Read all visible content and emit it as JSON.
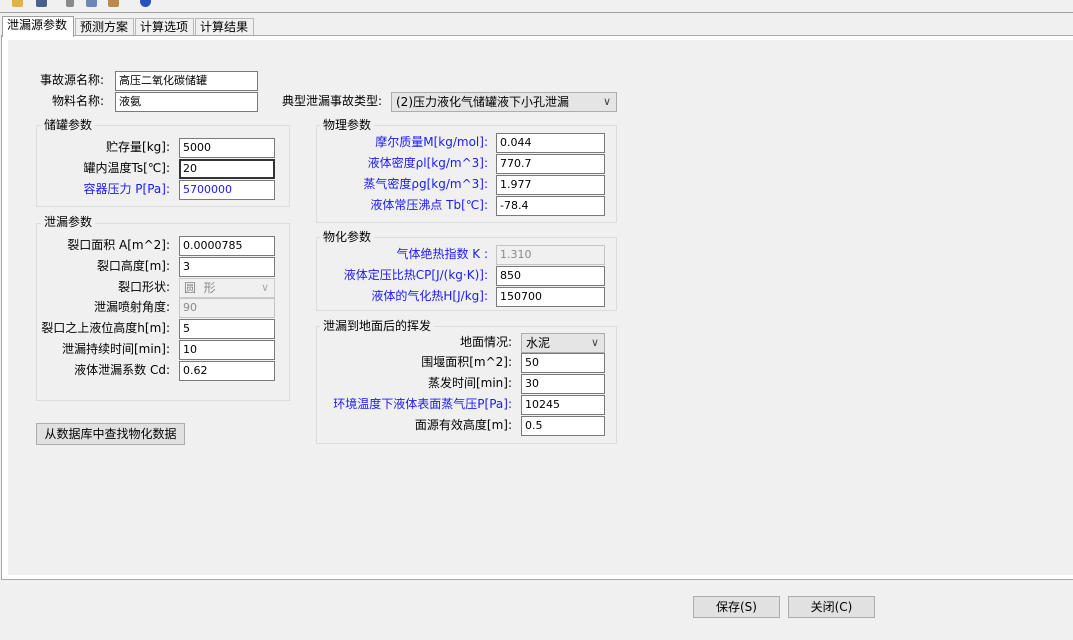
{
  "tabs": [
    "泄漏源参数",
    "预测方案",
    "计算选项",
    "计算结果"
  ],
  "header": {
    "source_name_label": "事故源名称:",
    "source_name_value": "高压二氧化碳储罐",
    "material_label": "物料名称:",
    "material_value": "液氨",
    "accident_type_label": "典型泄漏事故类型:",
    "accident_type_value": "(2)压力液化气储罐液下小孔泄漏"
  },
  "tank": {
    "title": "储罐参数",
    "fields": [
      {
        "label": "贮存量[kg]:",
        "value": "5000"
      },
      {
        "label": "罐内温度Ts[℃]:",
        "value": "20"
      },
      {
        "label": "容器压力 P[Pa]:",
        "value": "5700000"
      }
    ]
  },
  "leak": {
    "title": "泄漏参数",
    "area_label": "裂口面积 A[m^2]:",
    "area_value": "0.0000785",
    "height_label": "裂口高度[m]:",
    "height_value": "3",
    "shape_label": "裂口形状:",
    "shape_value": "圆  形",
    "angle_label": "泄漏喷射角度:",
    "angle_value": "90",
    "liquid_height_label": "裂口之上液位高度h[m]:",
    "liquid_height_value": "5",
    "duration_label": "泄漏持续时间[min]:",
    "duration_value": "10",
    "coef_label": "液体泄漏系数  Cd:",
    "coef_value": "0.62"
  },
  "phys": {
    "title": "物理参数",
    "fields": [
      {
        "label": "摩尔质量M[kg/mol]:",
        "value": "0.044"
      },
      {
        "label": "液体密度ρl[kg/m^3]:",
        "value": "770.7"
      },
      {
        "label": "蒸气密度ρg[kg/m^3]:",
        "value": "1.977"
      },
      {
        "label": "液体常压沸点 Tb[℃]:",
        "value": "-78.4"
      }
    ]
  },
  "chem": {
    "title": "物化参数",
    "fields": [
      {
        "label": "气体绝热指数  K :",
        "value": "1.310"
      },
      {
        "label": "液体定压比热CP[J/(kg·K)]:",
        "value": "850"
      },
      {
        "label": "液体的气化热H[J/kg]:",
        "value": "150700"
      }
    ]
  },
  "evap": {
    "title": "泄漏到地面后的挥发",
    "ground_label": "地面情况:",
    "ground_value": "水泥",
    "bund_label": "围堰面积[m^2]:",
    "bund_value": "50",
    "time_label": "蒸发时间[min]:",
    "time_value": "30",
    "vapor_label": "环境温度下液体表面蒸气压P[Pa]:",
    "vapor_value": "10245",
    "source_height_label": "面源有效高度[m]:",
    "source_height_value": "0.5"
  },
  "db_button": "从数据库中查找物化数据",
  "save_button": "保存(S)",
  "close_button": "关闭(C)"
}
